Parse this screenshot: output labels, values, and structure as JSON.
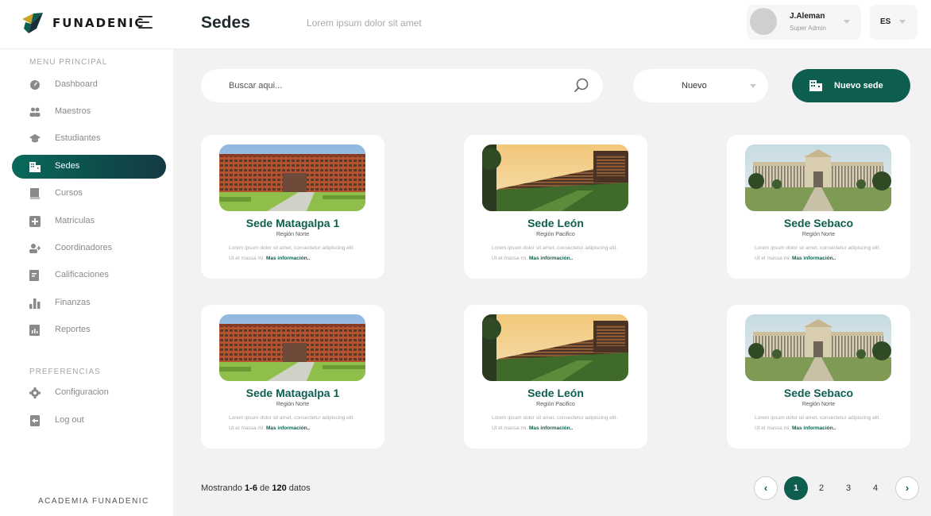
{
  "brand": {
    "name": "FUNADENIC"
  },
  "header": {
    "title": "Sedes",
    "subtitle": "Lorem ipsum  dolor sit amet"
  },
  "user": {
    "name": "J.Aleman",
    "role": "Super Admin"
  },
  "language": "ES",
  "sidebar": {
    "main_label": "MENU PRINCIPAL",
    "items": [
      {
        "label": "Dashboard",
        "icon": "dashboard-icon"
      },
      {
        "label": "Maestros",
        "icon": "teachers-icon"
      },
      {
        "label": "Estudiantes",
        "icon": "graduation-cap-icon"
      },
      {
        "label": "Sedes",
        "icon": "building-icon",
        "active": true
      },
      {
        "label": "Cursos",
        "icon": "book-icon"
      },
      {
        "label": "Matriculas",
        "icon": "plus-box-icon"
      },
      {
        "label": "Coordinadores",
        "icon": "add-user-icon"
      },
      {
        "label": "Calificaciones",
        "icon": "grades-icon"
      },
      {
        "label": "Finanzas",
        "icon": "bar-chart-icon"
      },
      {
        "label": "Reportes",
        "icon": "report-icon"
      }
    ],
    "pref_label": "PREFERENCIAS",
    "pref_items": [
      {
        "label": "Configuracion",
        "icon": "gear-icon"
      },
      {
        "label": "Log out",
        "icon": "logout-icon"
      }
    ],
    "footer": "ACADEMIA FUNADENIC"
  },
  "toolbar": {
    "search_placeholder": "Buscar aqui...",
    "filter_value": "Nuevo",
    "new_button_label": "Nuevo sede"
  },
  "cards": [
    {
      "title": "Sede Matagalpa 1",
      "region": "Región Norte",
      "desc": "Lorem ipsum dolor sit amet, consectetur adipiscing elit. Ut et massa mi.",
      "more": "Mas información..",
      "image": "matagalpa"
    },
    {
      "title": "Sede León",
      "region": "Región Pacifico",
      "desc": "Lorem ipsum dolor sit amet, consectetur adipiscing elit. Ut et massa mi.",
      "more": "Mas información..",
      "image": "leon"
    },
    {
      "title": "Sede Sebaco",
      "region": "Región Norte",
      "desc": "Lorem ipsum dolor sit amet, consectetur adipiscing elit. Ut et massa mi.",
      "more": "Mas información..",
      "image": "sebaco"
    },
    {
      "title": "Sede Matagalpa 1",
      "region": "Región Norte",
      "desc": "Lorem ipsum dolor sit amet, consectetur adipiscing elit. Ut et massa mi.",
      "more": "Mas información..",
      "image": "matagalpa"
    },
    {
      "title": "Sede León",
      "region": "Región Pacifico",
      "desc": "Lorem ipsum dolor sit amet, consectetur adipiscing elit. Ut et massa mi.",
      "more": "Mas información..",
      "image": "leon"
    },
    {
      "title": "Sede Sebaco",
      "region": "Región Norte",
      "desc": "Lorem ipsum dolor sit amet, consectetur adipiscing elit. Ut et massa mi.",
      "more": "Mas información..",
      "image": "sebaco"
    }
  ],
  "pagination": {
    "showing_prefix": "Mostrando",
    "range": "1-6",
    "of": "de",
    "total": "120",
    "suffix": "datos",
    "pages": [
      "1",
      "2",
      "3",
      "4"
    ],
    "current": "1"
  },
  "colors": {
    "accent": "#0d5e4e",
    "background": "#f2f2f2"
  }
}
